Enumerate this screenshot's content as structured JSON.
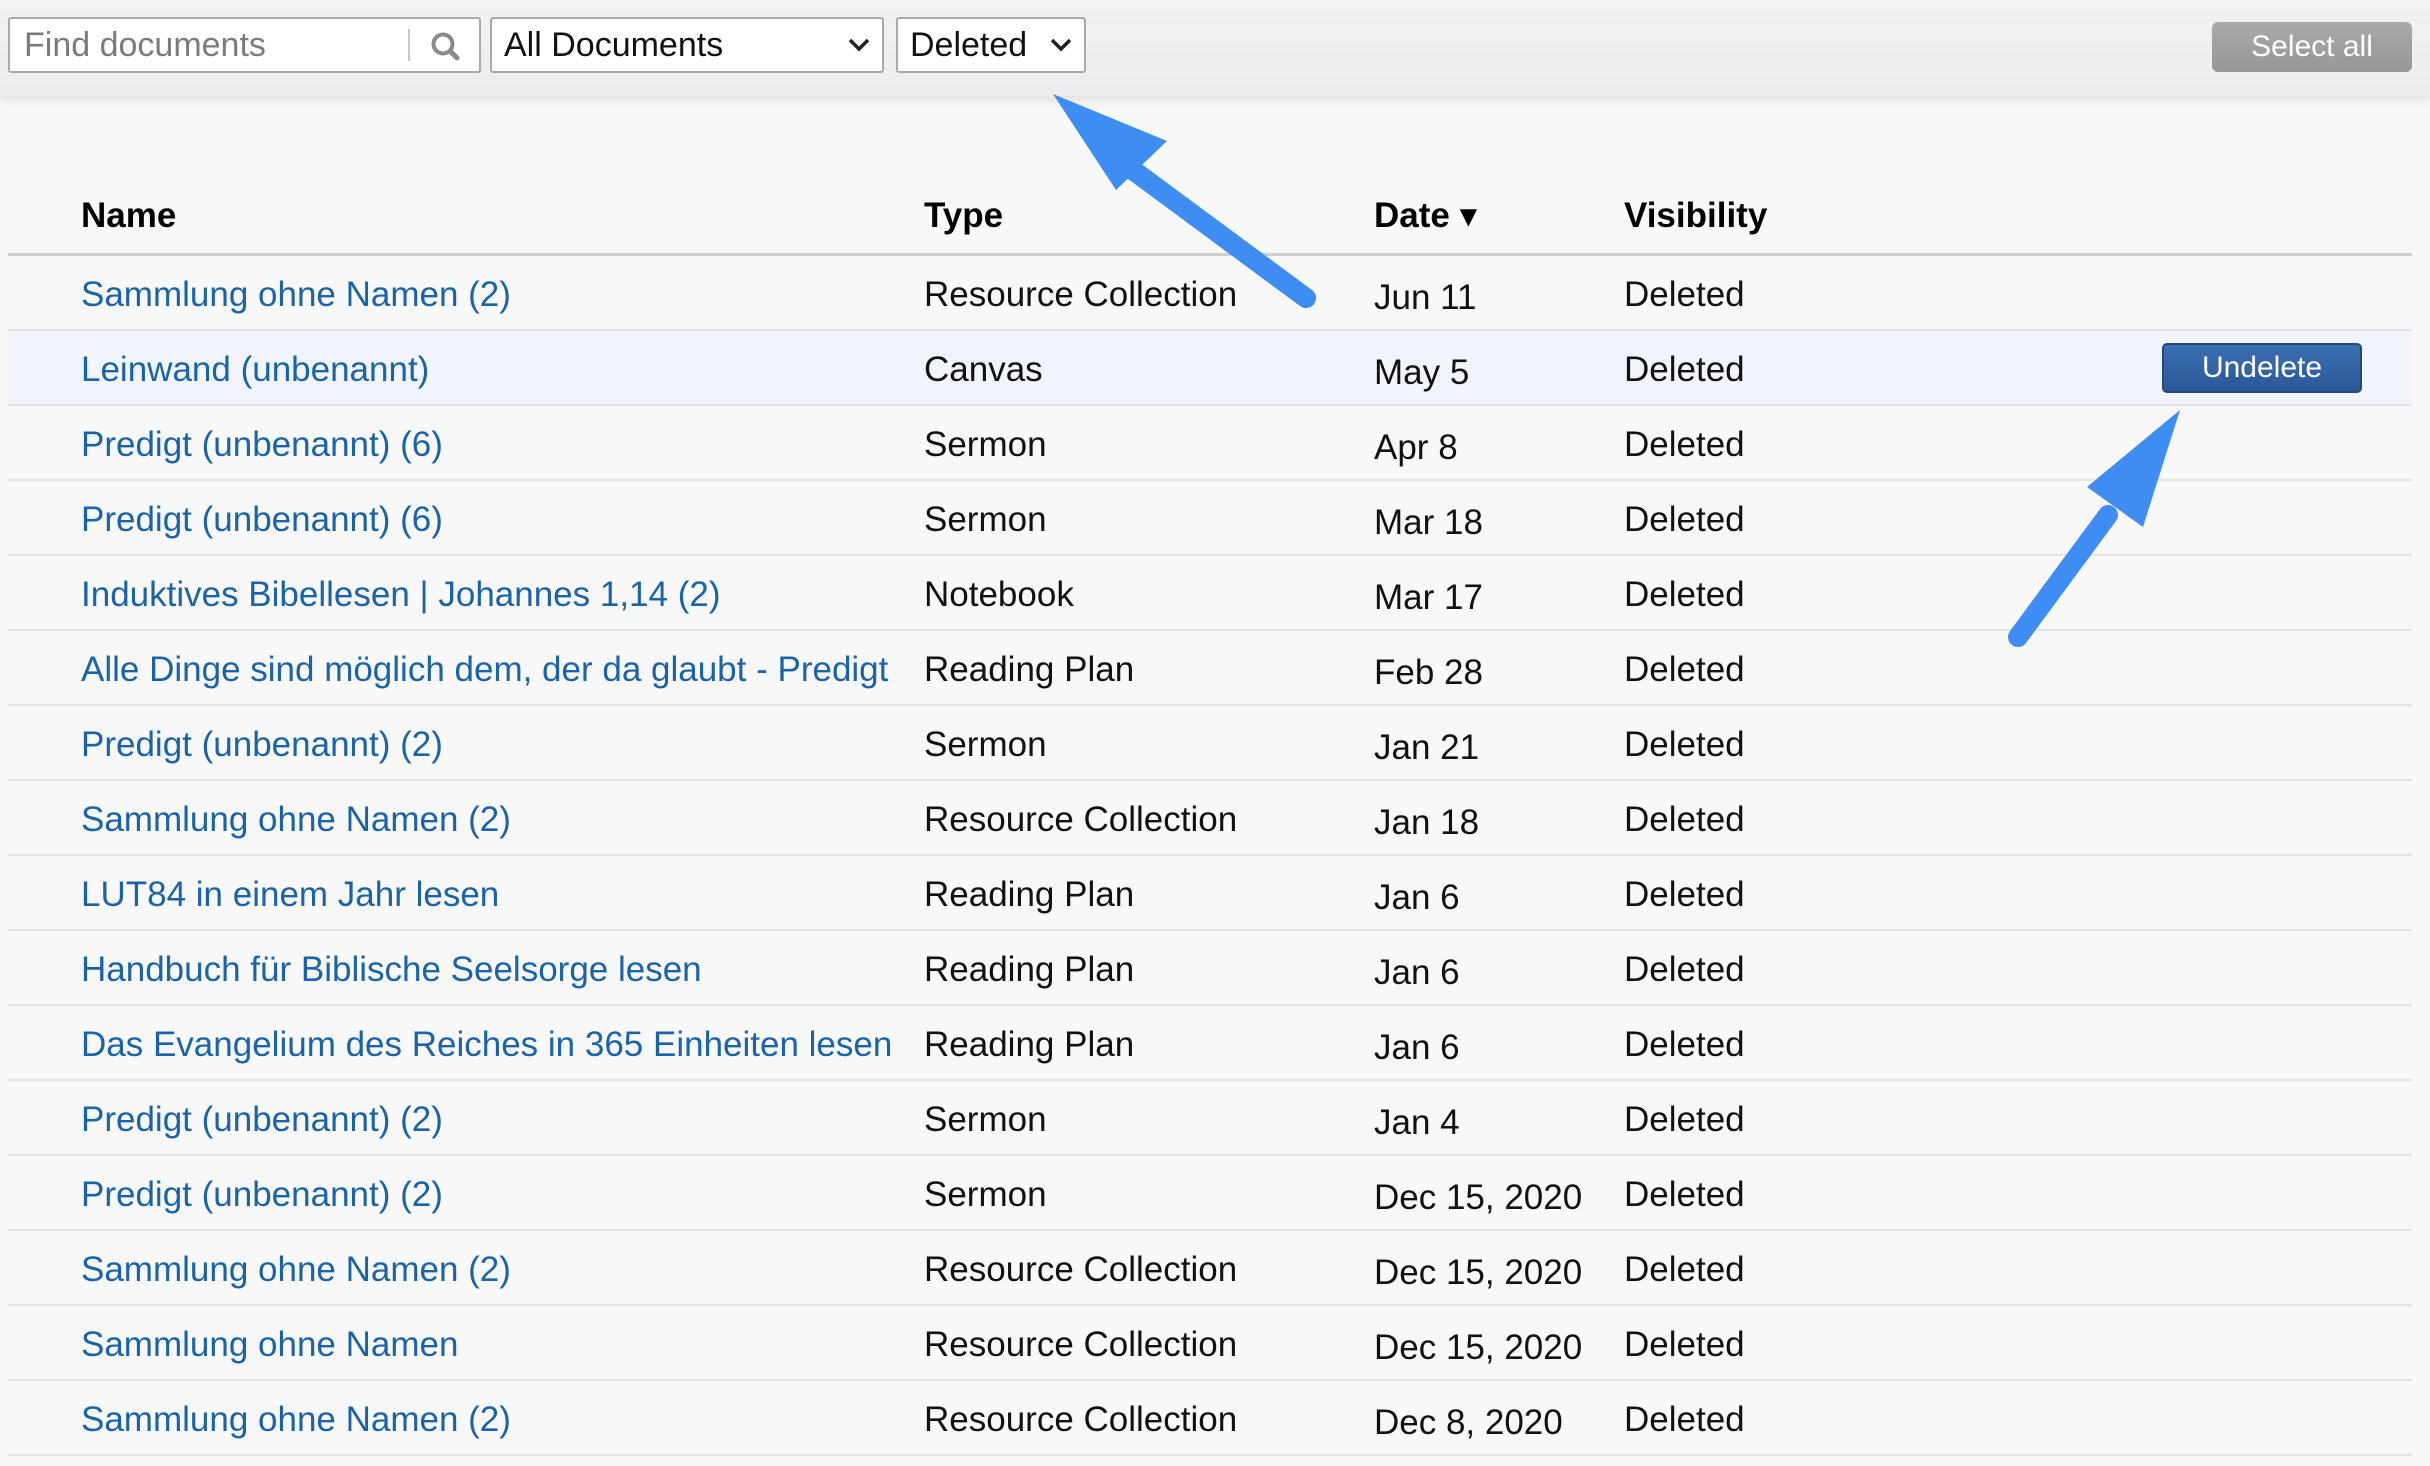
{
  "search": {
    "placeholder": "Find documents",
    "icon": "search-icon"
  },
  "filters": {
    "document_type": "All Documents",
    "status": "Deleted"
  },
  "toolbar": {
    "select_all_label": "Select all"
  },
  "table": {
    "headers": {
      "name": "Name",
      "type": "Type",
      "date": "Date ▾",
      "visibility": "Visibility"
    },
    "rows": [
      {
        "name": "Sammlung ohne Namen (2)",
        "type": "Resource Collection",
        "date": "Jun 11",
        "visibility": "Deleted"
      },
      {
        "name": "Leinwand (unbenannt)",
        "type": "Canvas",
        "date": "May 5",
        "visibility": "Deleted",
        "action": "Undelete"
      },
      {
        "name": "Predigt (unbenannt) (6)",
        "type": "Sermon",
        "date": "Apr 8",
        "visibility": "Deleted"
      },
      {
        "name": "Predigt (unbenannt) (6)",
        "type": "Sermon",
        "date": "Mar 18",
        "visibility": "Deleted"
      },
      {
        "name": "Induktives Bibellesen | Johannes 1,14 (2)",
        "type": "Notebook",
        "date": "Mar 17",
        "visibility": "Deleted"
      },
      {
        "name": "Alle Dinge sind möglich dem, der da glaubt - Predigt",
        "type": "Reading Plan",
        "date": "Feb 28",
        "visibility": "Deleted"
      },
      {
        "name": "Predigt (unbenannt) (2)",
        "type": "Sermon",
        "date": "Jan 21",
        "visibility": "Deleted"
      },
      {
        "name": "Sammlung ohne Namen (2)",
        "type": "Resource Collection",
        "date": "Jan 18",
        "visibility": "Deleted"
      },
      {
        "name": "LUT84 in einem Jahr lesen",
        "type": "Reading Plan",
        "date": "Jan 6",
        "visibility": "Deleted"
      },
      {
        "name": "Handbuch für Biblische Seelsorge lesen",
        "type": "Reading Plan",
        "date": "Jan 6",
        "visibility": "Deleted"
      },
      {
        "name": "Das Evangelium des Reiches in 365 Einheiten lesen",
        "type": "Reading Plan",
        "date": "Jan 6",
        "visibility": "Deleted"
      },
      {
        "name": "Predigt (unbenannt) (2)",
        "type": "Sermon",
        "date": "Jan 4",
        "visibility": "Deleted"
      },
      {
        "name": "Predigt (unbenannt) (2)",
        "type": "Sermon",
        "date": "Dec 15, 2020",
        "visibility": "Deleted"
      },
      {
        "name": "Sammlung ohne Namen (2)",
        "type": "Resource Collection",
        "date": "Dec 15, 2020",
        "visibility": "Deleted"
      },
      {
        "name": "Sammlung ohne Namen",
        "type": "Resource Collection",
        "date": "Dec 15, 2020",
        "visibility": "Deleted"
      },
      {
        "name": "Sammlung ohne Namen (2)",
        "type": "Resource Collection",
        "date": "Dec 8, 2020",
        "visibility": "Deleted"
      }
    ]
  },
  "colors": {
    "link": "#1a63a8",
    "accent_button": "#2f5e9e",
    "annotation_arrow": "#3d8df2"
  }
}
